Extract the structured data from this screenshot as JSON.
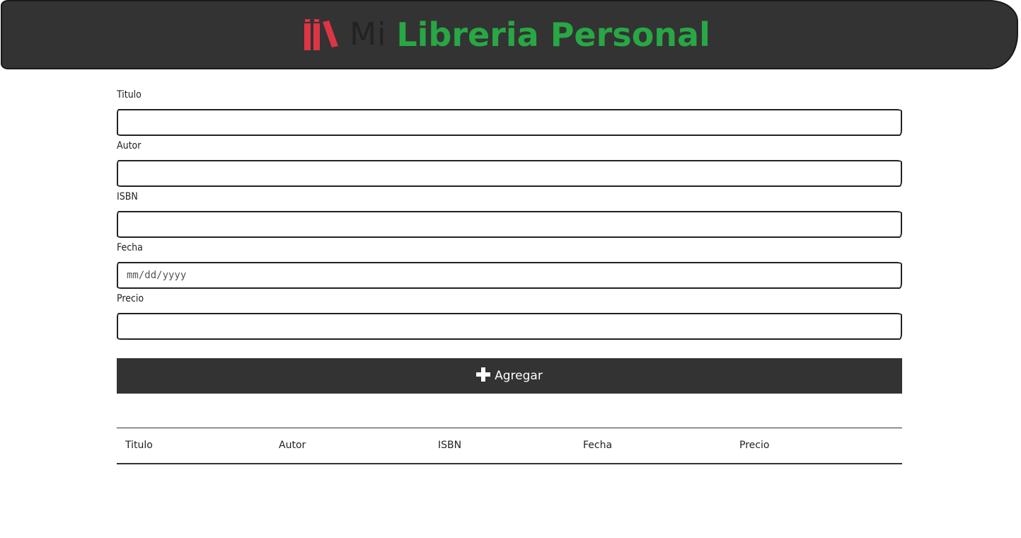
{
  "header": {
    "brand_prefix": "Mi",
    "brand_name": "Libreria Personal",
    "logo_icon": "books-icon",
    "brand_color": "#28a745",
    "logo_color": "#dc3545"
  },
  "form": {
    "titulo_label": "Titulo",
    "titulo_value": "",
    "autor_label": "Autor",
    "autor_value": "",
    "isbn_label": "ISBN",
    "isbn_value": "",
    "fecha_label": "Fecha",
    "fecha_placeholder": "mm/dd/yyyy",
    "precio_label": "Precio",
    "precio_value": ""
  },
  "add_button": {
    "label": "Agregar",
    "icon": "plus-icon"
  },
  "table": {
    "columns": [
      "Titulo",
      "Autor",
      "ISBN",
      "Fecha",
      "Precio"
    ],
    "rows": []
  }
}
